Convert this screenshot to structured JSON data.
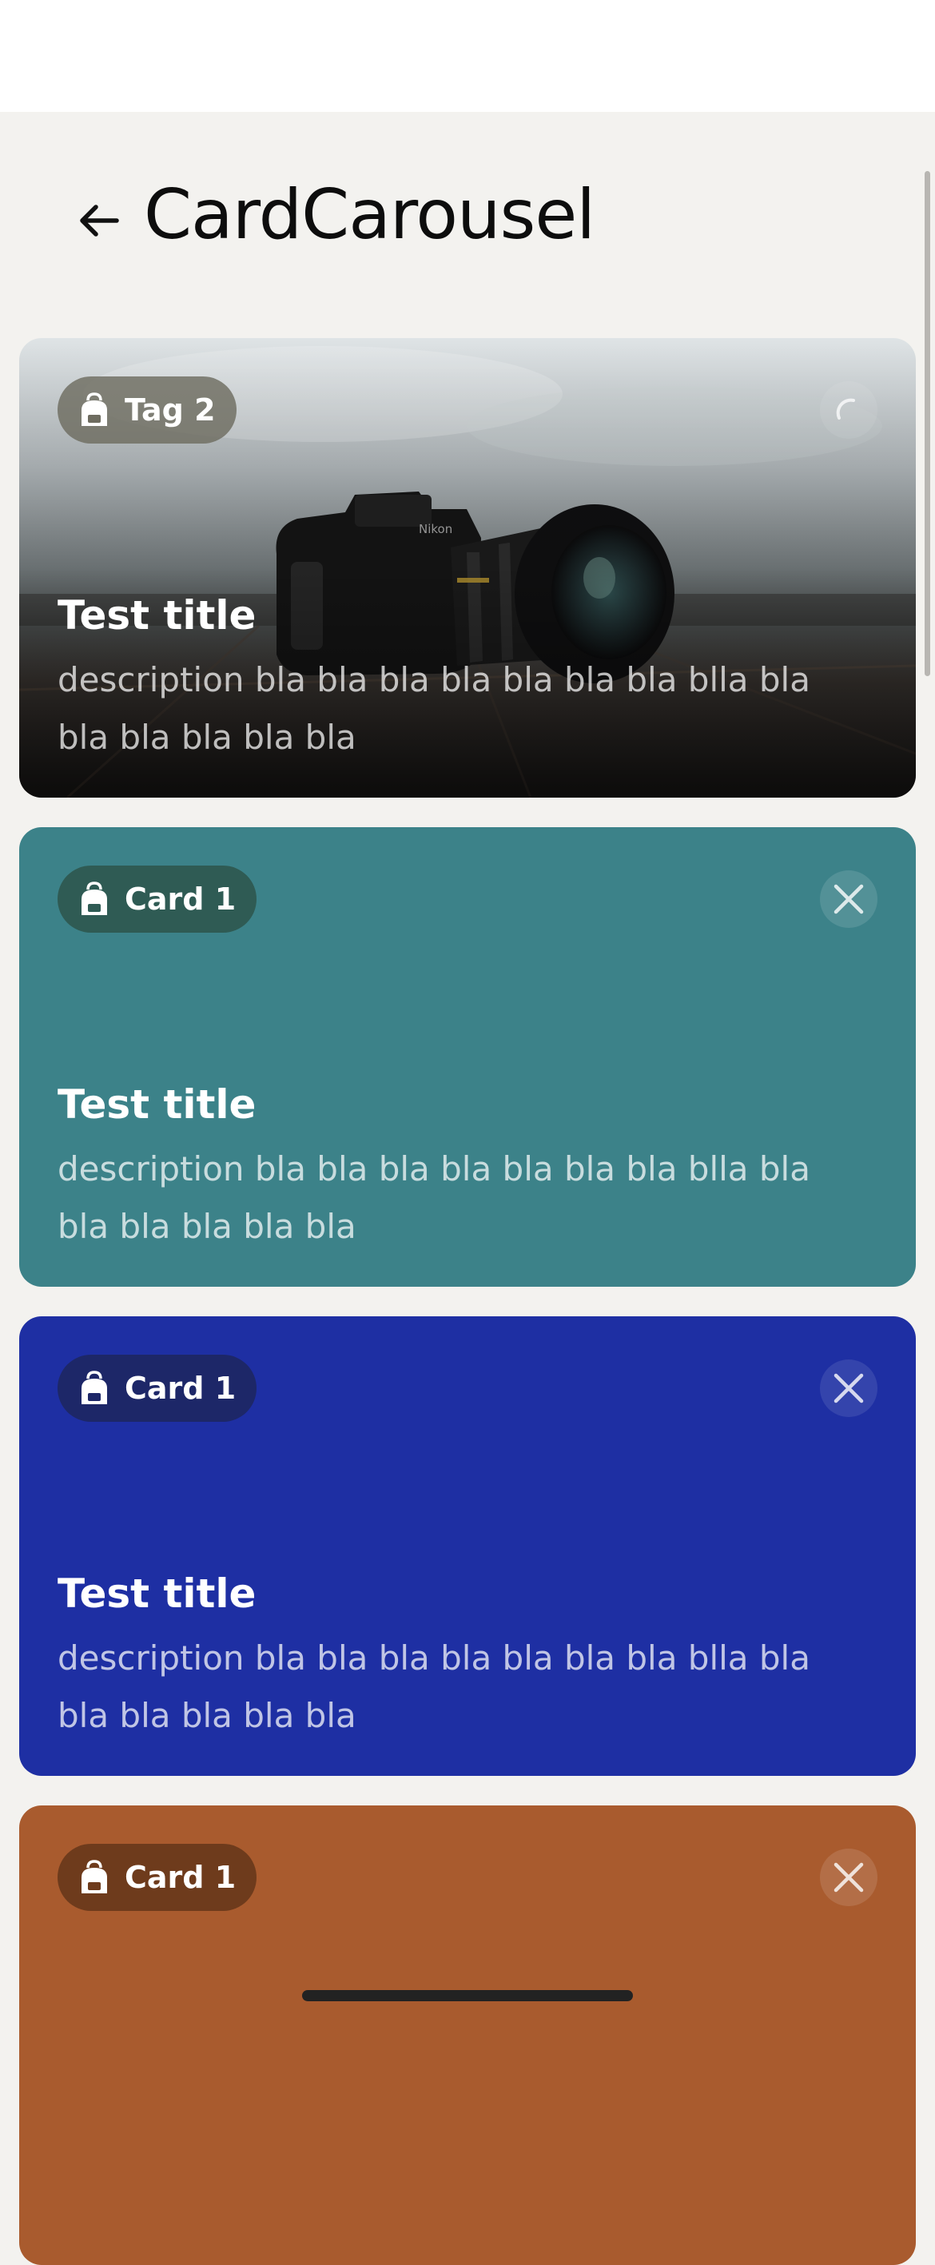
{
  "header": {
    "title": "CardCarousel",
    "back_icon": "arrow-left-icon"
  },
  "cards": [
    {
      "tag": "Tag 2",
      "tag_icon": "backpack-icon",
      "title": "Test title",
      "description": "description bla bla bla bla bla bla bla blla bla bla bla bla bla bla",
      "action_icon": "loading-spinner-icon",
      "background": "photo-camera-on-table"
    },
    {
      "tag": "Card 1",
      "tag_icon": "backpack-icon",
      "title": "Test title",
      "description": "description bla bla bla bla bla bla bla blla bla bla bla bla bla bla",
      "action_icon": "close-icon",
      "color": "#3c8289"
    },
    {
      "tag": "Card 1",
      "tag_icon": "backpack-icon",
      "title": "Test title",
      "description": "description bla bla bla bla bla bla bla blla bla bla bla bla bla bla",
      "action_icon": "close-icon",
      "color": "#1e2fa3"
    },
    {
      "tag": "Card 1",
      "tag_icon": "backpack-icon",
      "action_icon": "close-icon",
      "color": "#a95b2e"
    }
  ]
}
